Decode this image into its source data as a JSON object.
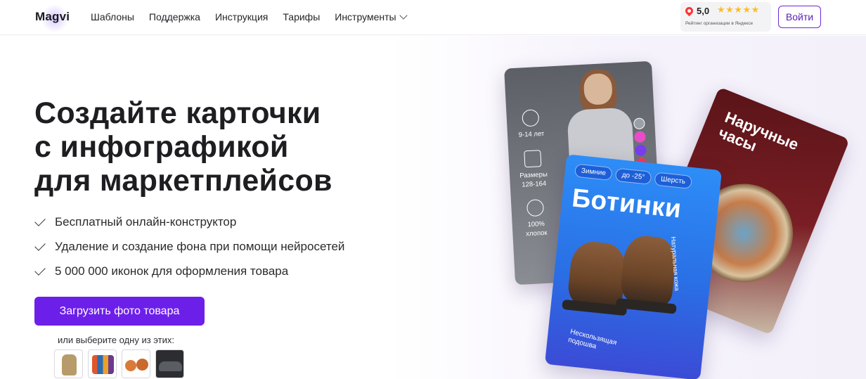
{
  "nav": {
    "logo": "Magvi",
    "links": [
      "Шаблоны",
      "Поддержка",
      "Инструкция",
      "Тарифы",
      "Инструменты"
    ],
    "rating_value": "5,0",
    "rating_stars": "★★★★★",
    "rating_caption": "Рейтинг организации в Яндексе",
    "login": "Войти"
  },
  "hero": {
    "title_lines": [
      "Создайте карточки",
      "с инфографикой",
      "для маркетплейсов"
    ],
    "features": [
      "Бесплатный онлайн-конструктор",
      "Удаление и создание фона при помощи нейросетей",
      "5 000 000 иконок для оформления товара"
    ],
    "cta": "Загрузить фото товара",
    "choose_text": "или выберите одну из этих:"
  },
  "cards": {
    "gray": {
      "age": "9-14 лет",
      "sizes_label": "Размеры",
      "sizes_value": "128-164",
      "material_value": "100%",
      "material_label": "хлопок"
    },
    "red": {
      "title_line1": "Наручные",
      "title_line2": "часы"
    },
    "blue": {
      "chips": [
        "Зимние",
        "до -25°",
        "Шерсть"
      ],
      "title": "Ботинки",
      "side_text": "Натуральная кожа",
      "bottom_text": "Нескользящая подошва"
    }
  },
  "colors": {
    "accent": "#6d1fea",
    "login_border": "#6d28d9",
    "star": "#fbbf24"
  }
}
